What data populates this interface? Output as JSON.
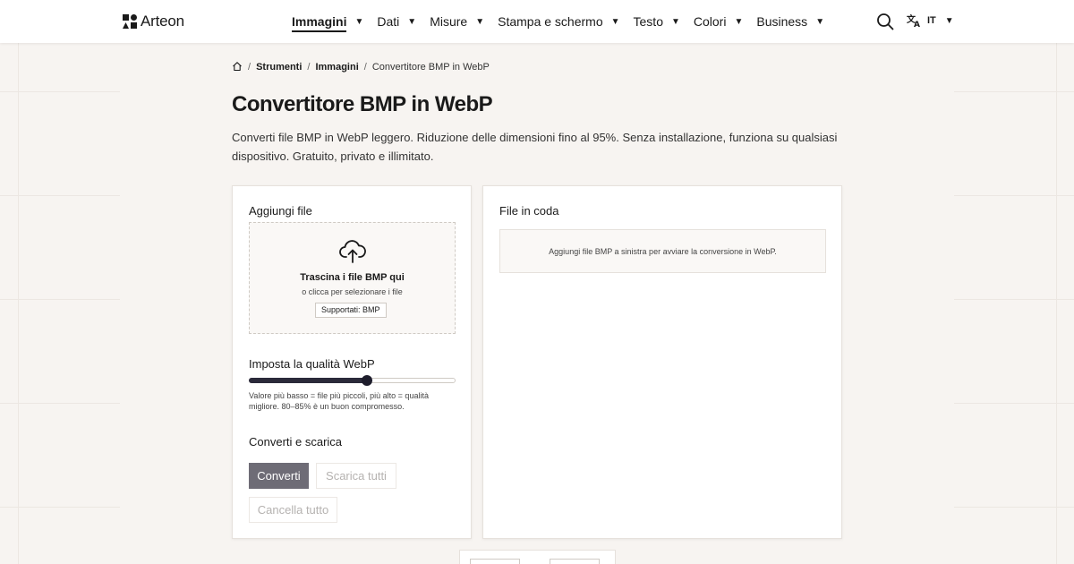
{
  "header": {
    "logo_text": "Arteon",
    "nav": [
      {
        "label": "Immagini",
        "active": true
      },
      {
        "label": "Dati",
        "active": false
      },
      {
        "label": "Misure",
        "active": false
      },
      {
        "label": "Stampa e schermo",
        "active": false
      },
      {
        "label": "Testo",
        "active": false
      },
      {
        "label": "Colori",
        "active": false
      },
      {
        "label": "Business",
        "active": false
      }
    ],
    "caret": "▼",
    "search_icon": "search-icon",
    "language_code": "IT",
    "language_icon": "translate-icon"
  },
  "breadcrumb": {
    "home_icon": "home-icon",
    "separator": "/",
    "items": [
      "Strumenti",
      "Immagini"
    ],
    "current": "Convertitore BMP in WebP"
  },
  "page": {
    "title": "Convertitore BMP in WebP",
    "description": "Converti file BMP in WebP leggero. Riduzione delle dimensioni fino al 95%. Senza installazione, funziona su qualsiasi dispositivo. Gratuito, privato e illimitato."
  },
  "upload": {
    "title": "Aggiungi file",
    "icon": "cloud-upload-icon",
    "drop_title": "Trascina i file BMP qui",
    "drop_sub": "o clicca per selezionare i file",
    "supported_badge": "Supportati: BMP"
  },
  "quality": {
    "title": "Imposta la qualità WebP",
    "value_fraction": 0.57,
    "hint": "Valore più basso = file più piccoli, più alto = qualità migliore. 80–85% è un buon compromesso."
  },
  "actions": {
    "title": "Converti e scarica",
    "convert_label": "Converti",
    "download_all_label": "Scarica tutti",
    "clear_all_label": "Cancella tutto"
  },
  "queue": {
    "title": "File in coda",
    "empty_message": "Aggiungi file BMP a sinistra per avviare la conversione in WebP."
  },
  "colors": {
    "primary_button": "#6e6c76",
    "slider_fill": "#2b2a3a",
    "background": "#f7f4f1"
  }
}
